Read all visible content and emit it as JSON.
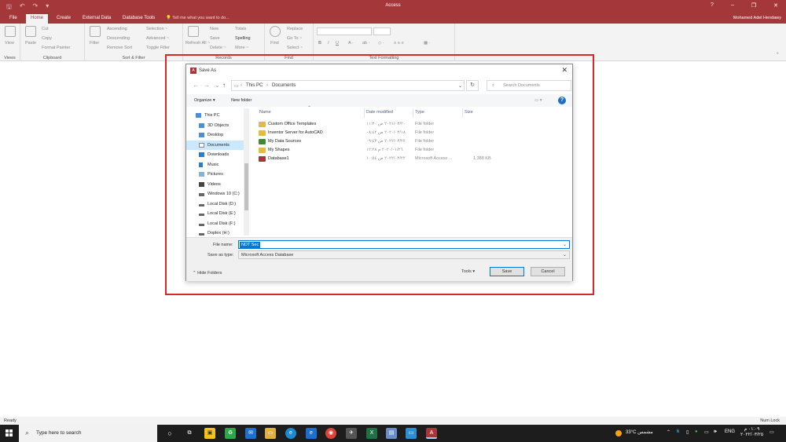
{
  "app": {
    "title": "Access",
    "user": "Mohamed Adel Hendawy",
    "window_controls": [
      "?",
      "–",
      "❐",
      "✕"
    ]
  },
  "ribbon": {
    "tabs": [
      "File",
      "Home",
      "Create",
      "External Data",
      "Database Tools"
    ],
    "active_tab": "Home",
    "tell_me": "Tell me what you want to do...",
    "groups": {
      "views": {
        "label": "Views",
        "view": "View"
      },
      "clipboard": {
        "label": "Clipboard",
        "paste": "Paste",
        "cut": "Cut",
        "copy": "Copy",
        "format_painter": "Format Painter"
      },
      "sort_filter": {
        "label": "Sort & Filter",
        "filter": "Filter",
        "ascending": "Ascending",
        "descending": "Descending",
        "remove_sort": "Remove Sort",
        "selection": "Selection ~",
        "advanced": "Advanced ~",
        "toggle_filter": "Toggle Filter"
      },
      "records": {
        "label": "Records",
        "refresh_all": "Refresh All ~",
        "new": "New",
        "save": "Save",
        "delete": "Delete ~",
        "totals": "Totals",
        "spelling": "Spelling",
        "more": "More ~"
      },
      "find": {
        "label": "Find",
        "find": "Find",
        "replace": "Replace",
        "go_to": "Go To ~",
        "select": "Select ~"
      },
      "text_formatting": {
        "label": "Text Formatting"
      }
    }
  },
  "dialog": {
    "title": "Save As",
    "path": [
      "This PC",
      "Documents"
    ],
    "search_placeholder": "Search Documents",
    "organize": "Organize ▾",
    "new_folder": "New folder",
    "nav": [
      {
        "label": "This PC",
        "icon": "pc-icon"
      },
      {
        "label": "3D Objects",
        "icon": "cube-icon"
      },
      {
        "label": "Desktop",
        "icon": "desktop-icon"
      },
      {
        "label": "Documents",
        "icon": "documents-icon",
        "selected": true
      },
      {
        "label": "Downloads",
        "icon": "download-icon"
      },
      {
        "label": "Music",
        "icon": "music-icon"
      },
      {
        "label": "Pictures",
        "icon": "pictures-icon"
      },
      {
        "label": "Videos",
        "icon": "video-icon"
      },
      {
        "label": "Windows 10 (C:)",
        "icon": "drive-icon"
      },
      {
        "label": "Local Disk (D:)",
        "icon": "drive-icon"
      },
      {
        "label": "Local Disk (E:)",
        "icon": "drive-icon"
      },
      {
        "label": "Local Disk (F:)",
        "icon": "drive-icon"
      },
      {
        "label": "Doplex (H:)",
        "icon": "drive-icon"
      }
    ],
    "columns": [
      "Name",
      "Date modified",
      "Type",
      "Size"
    ],
    "files": [
      {
        "name": "Custom Office Templates",
        "date": "٢٠٢١/٠٣/٢٠ ص ١١:٣٠",
        "type": "File folder",
        "size": "",
        "kind": "folder"
      },
      {
        "name": "Inventor Server for AutoCAD",
        "date": "٢٠٢٠/٠٣/١٨ ص ٠٨:٤٢",
        "type": "File folder",
        "size": "",
        "kind": "folder"
      },
      {
        "name": "My Data Sources",
        "date": "٢٠٢٢/٠٣/٢٢ ص ٠٩:٤٣",
        "type": "File folder",
        "size": "",
        "kind": "datasource"
      },
      {
        "name": "My Shapes",
        "date": "٢٠٢٠/٠١/٢٦ م ١٢:٢٨",
        "type": "File folder",
        "size": "",
        "kind": "folder"
      },
      {
        "name": "Database1",
        "date": "٢٠٢٢/٠٣/٢٢ ص ١٠:٥٤",
        "type": "Microsoft Access ...",
        "size": "1,388 KB",
        "kind": "database"
      }
    ],
    "file_name_label": "File name:",
    "file_name_value": "NDT Sec",
    "save_type_label": "Save as type:",
    "save_type_value": "Microsoft Access Database",
    "hide_folders": "Hide Folders",
    "tools": "Tools",
    "save": "Save",
    "cancel": "Cancel"
  },
  "status": {
    "left": "Ready",
    "right": "Num Lock"
  },
  "taskbar": {
    "search_placeholder": "Type here to search",
    "weather": "33°C  مشمس",
    "language": "ENG",
    "time": "٠١:٠٩ م",
    "date": "٢٠٢٢/٠٣/٢٥"
  },
  "colors": {
    "access_red": "#a4373a",
    "highlight_red": "#d62828",
    "accent_blue": "#0078d7"
  }
}
